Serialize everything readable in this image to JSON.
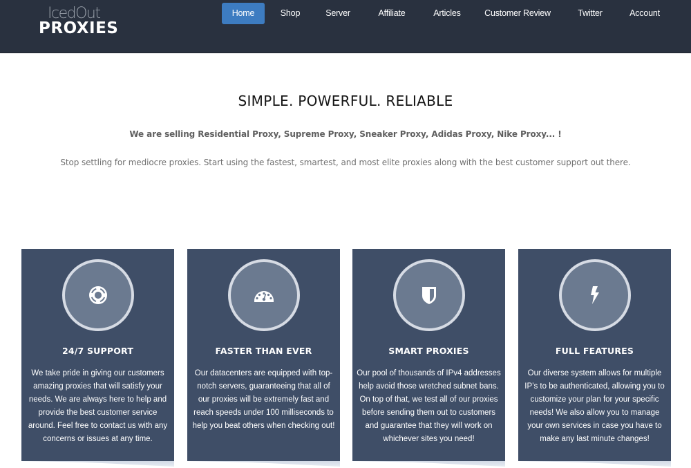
{
  "header": {
    "logo": {
      "top": "IcedOut",
      "bottom": "PROXIES"
    },
    "nav": [
      {
        "label": "Home",
        "active": true
      },
      {
        "label": "Shop",
        "active": false
      },
      {
        "label": "Server",
        "active": false
      },
      {
        "label": "Affiliate",
        "active": false
      },
      {
        "label": "Articles",
        "active": false
      },
      {
        "label": "Customer Review",
        "active": false
      },
      {
        "label": "Twitter",
        "active": false
      },
      {
        "label": "Account",
        "active": false
      }
    ]
  },
  "hero": {
    "title": "SIMPLE. POWERFUL. RELIABLE",
    "subtitle": "We are selling Residential Proxy, Supreme Proxy, Sneaker Proxy, Adidas Proxy, Nike Proxy... !",
    "description": "Stop settling for mediocre proxies. Start using the fastest, smartest, and most elite proxies along with the best customer support out there."
  },
  "features": [
    {
      "icon": "life-ring-icon",
      "title": "24/7 SUPPORT",
      "text": "We take pride in giving our customers amazing proxies that will satisfy your needs. We are always here to help and provide the best customer service around. Feel free to contact us with any concerns or issues at any time."
    },
    {
      "icon": "speedometer-icon",
      "title": "FASTER THAN EVER",
      "text": "Our datacenters are equipped with top-notch servers, guaranteeing that all of our proxies will be extremely fast and reach speeds under 100 milliseconds to help you beat others when checking out!"
    },
    {
      "icon": "shield-icon",
      "title": "SMART PROXIES",
      "text": "Our pool of thousands of IPv4 addresses help avoid those wretched subnet bans. On top of that, we test all of our proxies before sending them out to customers and guarantee that they will work on whichever sites you need!"
    },
    {
      "icon": "bolt-icon",
      "title": "FULL FEATURES",
      "text": "Our diverse system allows for multiple IP’s to be  authenticated, allowing you to customize your plan for your specific needs! We also allow you to manage your own services in case you have to make any last minute changes!"
    }
  ],
  "colors": {
    "header_bg": "#29313f",
    "nav_active": "#3d7cc1",
    "card_bg": "#3f4e67",
    "circle_bg": "#6b7a90",
    "circle_border": "#d6dbe4"
  }
}
